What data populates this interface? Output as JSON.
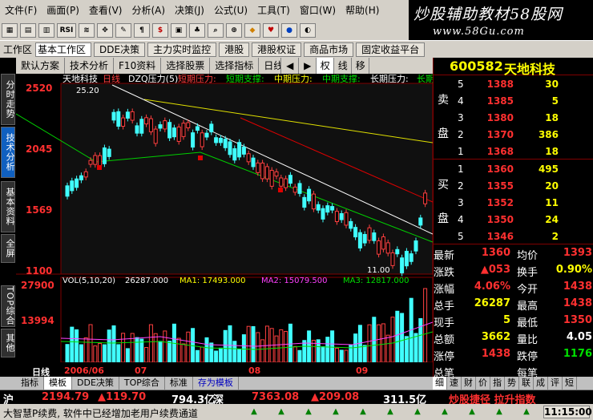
{
  "menu": [
    "文件(F)",
    "画面(P)",
    "查看(V)",
    "分析(A)",
    "决策(J)",
    "公式(U)",
    "工具(T)",
    "窗口(W)",
    "帮助(H)"
  ],
  "brand": {
    "title": "炒股辅助教材58股网",
    "url": "www.58Gu.com"
  },
  "toolbar": {
    "icons": [
      "grid-icon",
      "layout-icon",
      "report-icon",
      "RSI",
      "chart-icon",
      "move-icon",
      "pen-icon",
      "text-icon",
      "dollar-icon",
      "display-icon",
      "tree-icon",
      "search-icon",
      "zoom-icon",
      "diamond-icon",
      "heart-icon",
      "sphere-icon",
      "toggle-icon"
    ],
    "rsi_label": "RSI",
    "dollar_label": "$"
  },
  "workbar": {
    "label": "工作区",
    "select": "基本工作区",
    "buttons": [
      "DDE决策",
      "主力实时监控",
      "港股",
      "港股权证",
      "商品市场",
      "固定收益平台"
    ]
  },
  "chartbar": {
    "tabs": [
      "默认方案",
      "技术分析",
      "F10资料",
      "选择股票",
      "选择指标",
      "日线"
    ],
    "icons": [
      "◀",
      "▶",
      "权",
      "线",
      "移"
    ]
  },
  "lefttabs": [
    "分时走势",
    "技术分析",
    "基本资料",
    "全屏",
    "TOP综合",
    "其他"
  ],
  "legend": {
    "stock": "天地科技",
    "period": "日线",
    "indicator": "DZQ压力(5)",
    "items": [
      "短期压力:",
      "短期支撑:",
      "中期压力:",
      "中期支撑:",
      "长期压力:",
      "长期"
    ]
  },
  "price_axis": [
    "2520",
    "2045",
    "1569",
    "1100"
  ],
  "vol_axis": [
    "27900",
    "13994"
  ],
  "annot": {
    "high": "25.20",
    "low": "11.00"
  },
  "vol_legend": {
    "title": "VOL(5,10,20)",
    "vol": "26287.000",
    "ma1": "MA1: 17493.000",
    "ma2": "MA2: 15079.500",
    "ma3": "MA3: 12817.000"
  },
  "date_axis": {
    "label": "日线",
    "dates": [
      "2006/06",
      "07",
      "08",
      "09"
    ]
  },
  "bottomtabs": [
    "指标",
    "模板",
    "DDE决策",
    "TOP综合",
    "标准",
    "存为模板"
  ],
  "rpanel": {
    "code": "600582",
    "name": "天地科技",
    "sell_label": [
      "卖",
      "盘"
    ],
    "buy_label": [
      "买",
      "盘"
    ],
    "asks": [
      {
        "level": "5",
        "price": "1388",
        "vol": "30"
      },
      {
        "level": "4",
        "price": "1385",
        "vol": "5"
      },
      {
        "level": "3",
        "price": "1380",
        "vol": "18"
      },
      {
        "level": "2",
        "price": "1370",
        "vol": "386"
      },
      {
        "level": "1",
        "price": "1368",
        "vol": "18"
      }
    ],
    "bids": [
      {
        "level": "1",
        "price": "1360",
        "vol": "495"
      },
      {
        "level": "2",
        "price": "1355",
        "vol": "20"
      },
      {
        "level": "3",
        "price": "1352",
        "vol": "11"
      },
      {
        "level": "4",
        "price": "1350",
        "vol": "24"
      },
      {
        "level": "5",
        "price": "1346",
        "vol": "2"
      }
    ],
    "quotes": [
      {
        "l1": "最新",
        "v1": "1360",
        "c1": "red",
        "l2": "均价",
        "v2": "1393",
        "c2": "red"
      },
      {
        "l1": "涨跌",
        "v1": "▲053",
        "c1": "red",
        "l2": "换手",
        "v2": "0.90%",
        "c2": "yel"
      },
      {
        "l1": "涨幅",
        "v1": "4.06%",
        "c1": "red",
        "l2": "今开",
        "v2": "1438",
        "c2": "red"
      },
      {
        "l1": "总手",
        "v1": "26287",
        "c1": "yel",
        "l2": "最高",
        "v2": "1438",
        "c2": "red"
      },
      {
        "l1": "现手",
        "v1": "5",
        "c1": "yel",
        "l2": "最低",
        "v2": "1350",
        "c2": "red"
      },
      {
        "l1": "总额",
        "v1": "3662",
        "c1": "yel",
        "l2": "量比",
        "v2": "4.05",
        "c2": "wh"
      },
      {
        "l1": "涨停",
        "v1": "1438",
        "c1": "red",
        "l2": "跌停",
        "v2": "1176",
        "c2": "grn"
      },
      {
        "l1": "总笔",
        "v1": "",
        "c1": "wh",
        "l2": "每笔",
        "v2": "",
        "c2": "wh"
      }
    ]
  },
  "rtabs": [
    "细",
    "速",
    "财",
    "价",
    "指",
    "势",
    "联",
    "成",
    "评",
    "短"
  ],
  "status1": {
    "sh": "沪",
    "sh_idx": "2194.79",
    "sh_chg": "▲119.70",
    "sh_amt": "794.3亿",
    "sz": "深",
    "sz_idx": "7363.08",
    "sz_chg": "▲209.08",
    "sz_amt": "311.5亿",
    "news": "炒股捷径 拉升指数"
  },
  "status2": {
    "msg": "大智慧P续费, 软件中已经增加老用户续费通道",
    "time": "11:15:00"
  }
}
